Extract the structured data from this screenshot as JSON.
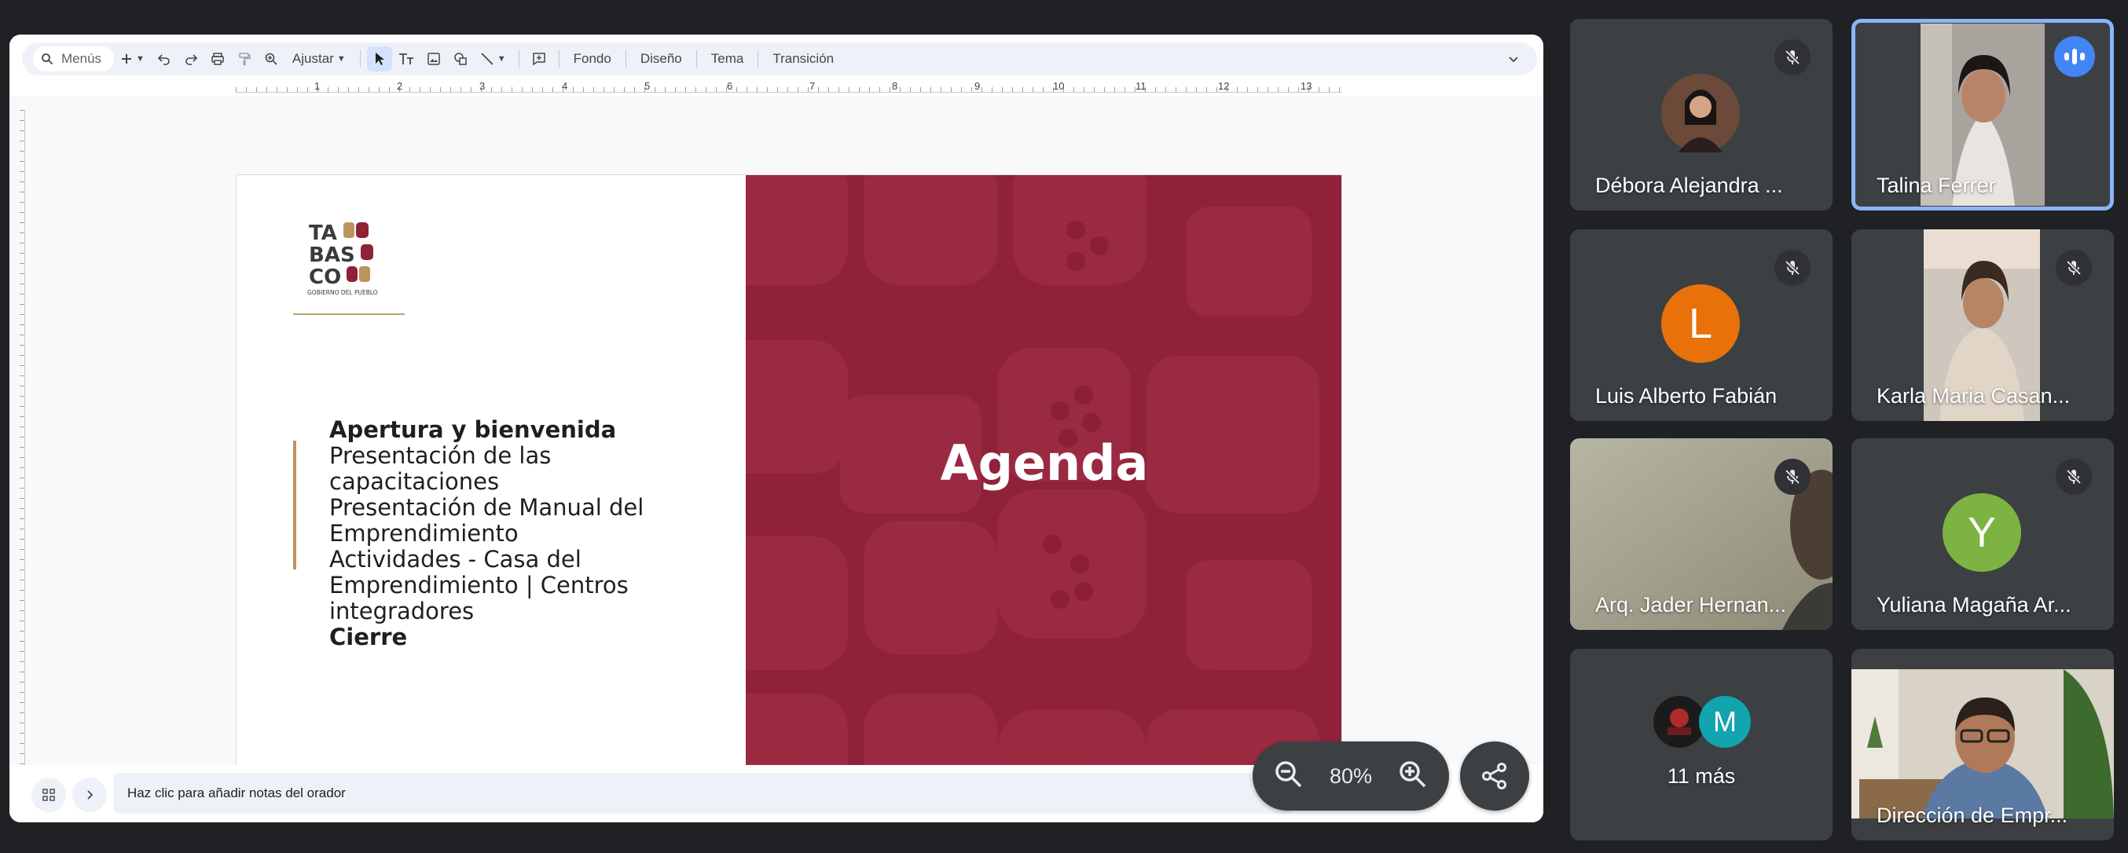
{
  "toolbar": {
    "search_label": "Menús",
    "zoom_fit_label": "Ajustar",
    "background_label": "Fondo",
    "layout_label": "Diseño",
    "theme_label": "Tema",
    "transition_label": "Transición"
  },
  "ruler": {
    "marks": [
      "1",
      "2",
      "3",
      "4",
      "5",
      "6",
      "7",
      "8",
      "9",
      "10",
      "11",
      "12",
      "13"
    ]
  },
  "slide": {
    "logo_lines": [
      "TA",
      "BAS",
      "CO"
    ],
    "logo_caption": "GOBIERNO DEL PUEBLO",
    "title": "Agenda",
    "items": [
      "Apertura y bienvenida",
      "Presentación de las",
      "capacitaciones",
      "Presentación de Manual del",
      "Emprendimiento",
      "Actividades - Casa del",
      "Emprendimiento | Centros",
      "integradores",
      "Cierre"
    ],
    "accent_color": "#8f2238"
  },
  "notes": {
    "placeholder": "Haz clic para añadir notas del orador"
  },
  "zoom": {
    "value": "80%"
  },
  "participants": [
    {
      "name": "Débora Alejandra ...",
      "mic": "muted"
    },
    {
      "name": "Talina Ferrer",
      "mic": "speaking"
    },
    {
      "name": "Luis Alberto Fabián",
      "mic": "muted",
      "initial": "L",
      "color": "#e8710a"
    },
    {
      "name": "Karla Maria Casan...",
      "mic": "muted"
    },
    {
      "name": "Arq. Jader Hernan...",
      "mic": "muted"
    },
    {
      "name": "Yuliana Magaña Ar...",
      "mic": "muted",
      "initial": "Y",
      "color": "#7cb342"
    },
    {
      "name": "11 más",
      "initial": "M",
      "color": "#12a4af"
    },
    {
      "name": "Dirección de Empr..."
    }
  ]
}
